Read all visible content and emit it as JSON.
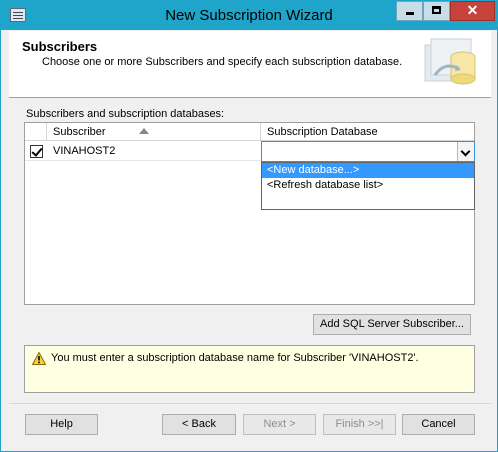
{
  "window": {
    "title": "New Subscription Wizard"
  },
  "header": {
    "title": "Subscribers",
    "subtitle": "Choose one or more Subscribers and specify each subscription database."
  },
  "grid": {
    "label": "Subscribers and subscription databases:",
    "columns": {
      "subscriber": "Subscriber",
      "database": "Subscription Database"
    },
    "rows": [
      {
        "checked": true,
        "subscriber": "VINAHOST2",
        "database": ""
      }
    ],
    "dropdown_options": [
      "<New database...>",
      "<Refresh database list>"
    ],
    "dropdown_selected": "<New database...>"
  },
  "buttons": {
    "add_subscriber": "Add SQL Server Subscriber...",
    "help": "Help",
    "back": "< Back",
    "next": "Next >",
    "finish": "Finish >>|",
    "cancel": "Cancel"
  },
  "message": "You must enter a subscription database name for Subscriber 'VINAHOST2'.",
  "colors": {
    "titlebar": "#1fa5c9",
    "selection": "#3399ff",
    "message_bg": "#ffffe1"
  }
}
